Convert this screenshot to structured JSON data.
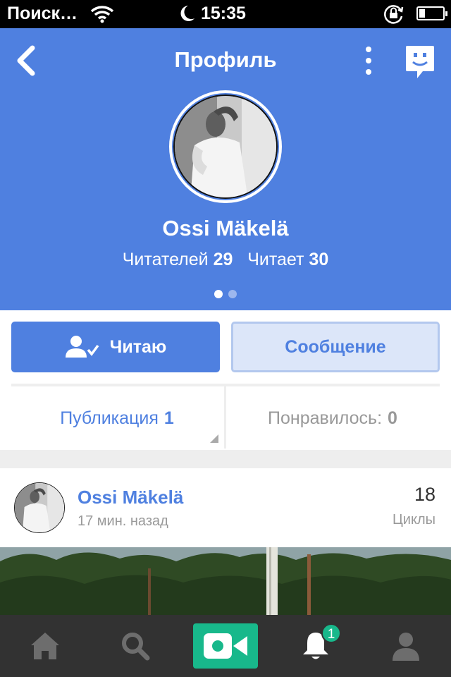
{
  "status_bar": {
    "carrier": "Поиск…",
    "time": "15:35"
  },
  "header": {
    "title": "Профиль",
    "back_icon": "chevron-left-icon",
    "more_icon": "more-vertical-icon",
    "chat_icon": "chat-smiley-icon",
    "background_color": "#4f80e0"
  },
  "profile": {
    "name": "Ossi Mäkelä",
    "followers_label": "Читателей",
    "followers_count": "29",
    "following_label": "Читает",
    "following_count": "30",
    "page_count": 2,
    "active_page": 1
  },
  "actions": {
    "follow_label": "Читаю",
    "message_label": "Сообщение"
  },
  "tabs": {
    "posts_label": "Публикация",
    "posts_count": "1",
    "likes_label": "Понравилось:",
    "likes_count": "0"
  },
  "post": {
    "author": "Ossi Mäkelä",
    "time": "17 мин. назад",
    "loops_count": "18",
    "loops_label": "Циклы"
  },
  "bottom_nav": {
    "items": [
      "home-icon",
      "search-icon",
      "video-camera-icon",
      "bell-icon",
      "profile-icon"
    ],
    "notification_badge": "1",
    "accent_color": "#18b88b"
  }
}
